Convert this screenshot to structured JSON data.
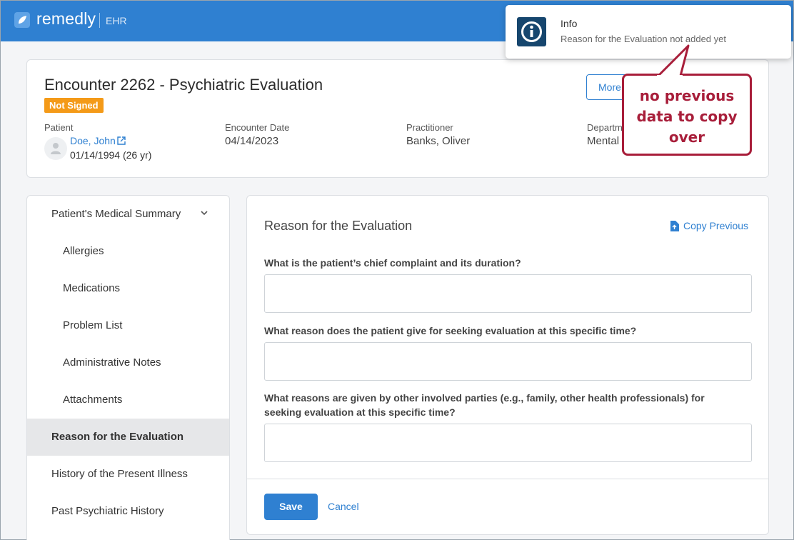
{
  "app": {
    "brand": "remedly",
    "module": "EHR"
  },
  "encounter": {
    "title": "Encounter 2262 - Psychiatric Evaluation",
    "status_badge": "Not Signed",
    "more_button": "More",
    "fields": {
      "patient_label": "Patient",
      "patient_name": "Doe, John",
      "patient_dob": "01/14/1994 (26 yr)",
      "date_label": "Encounter Date",
      "date_value": "04/14/2023",
      "practitioner_label": "Practitioner",
      "practitioner_value": "Banks, Oliver",
      "department_label": "Departm",
      "department_value": "Mental"
    }
  },
  "sidebar": {
    "parent": "Patient's Medical Summary",
    "children": [
      "Allergies",
      "Medications",
      "Problem List",
      "Administrative Notes",
      "Attachments"
    ],
    "items": [
      "Reason for the Evaluation",
      "History of the Present Illness",
      "Past Psychiatric History"
    ],
    "active": "Reason for the Evaluation"
  },
  "form": {
    "section_title": "Reason for the Evaluation",
    "copy_previous": "Copy Previous",
    "questions": [
      "What is the patient’s chief complaint and its duration?",
      "What reason does the patient give for seeking evaluation at this specific time?",
      "What reasons are given by other involved parties (e.g., family, other health professionals) for seeking evaluation at this specific time?"
    ],
    "save_label": "Save",
    "cancel_label": "Cancel"
  },
  "toast": {
    "title": "Info",
    "message": "Reason for the Evaluation not added yet"
  },
  "annotation": {
    "text": "no previous data to copy over"
  },
  "colors": {
    "primary": "#2f80d1",
    "badge": "#f49a18",
    "annotation": "#a81e3a",
    "toast_icon": "#16466e"
  }
}
